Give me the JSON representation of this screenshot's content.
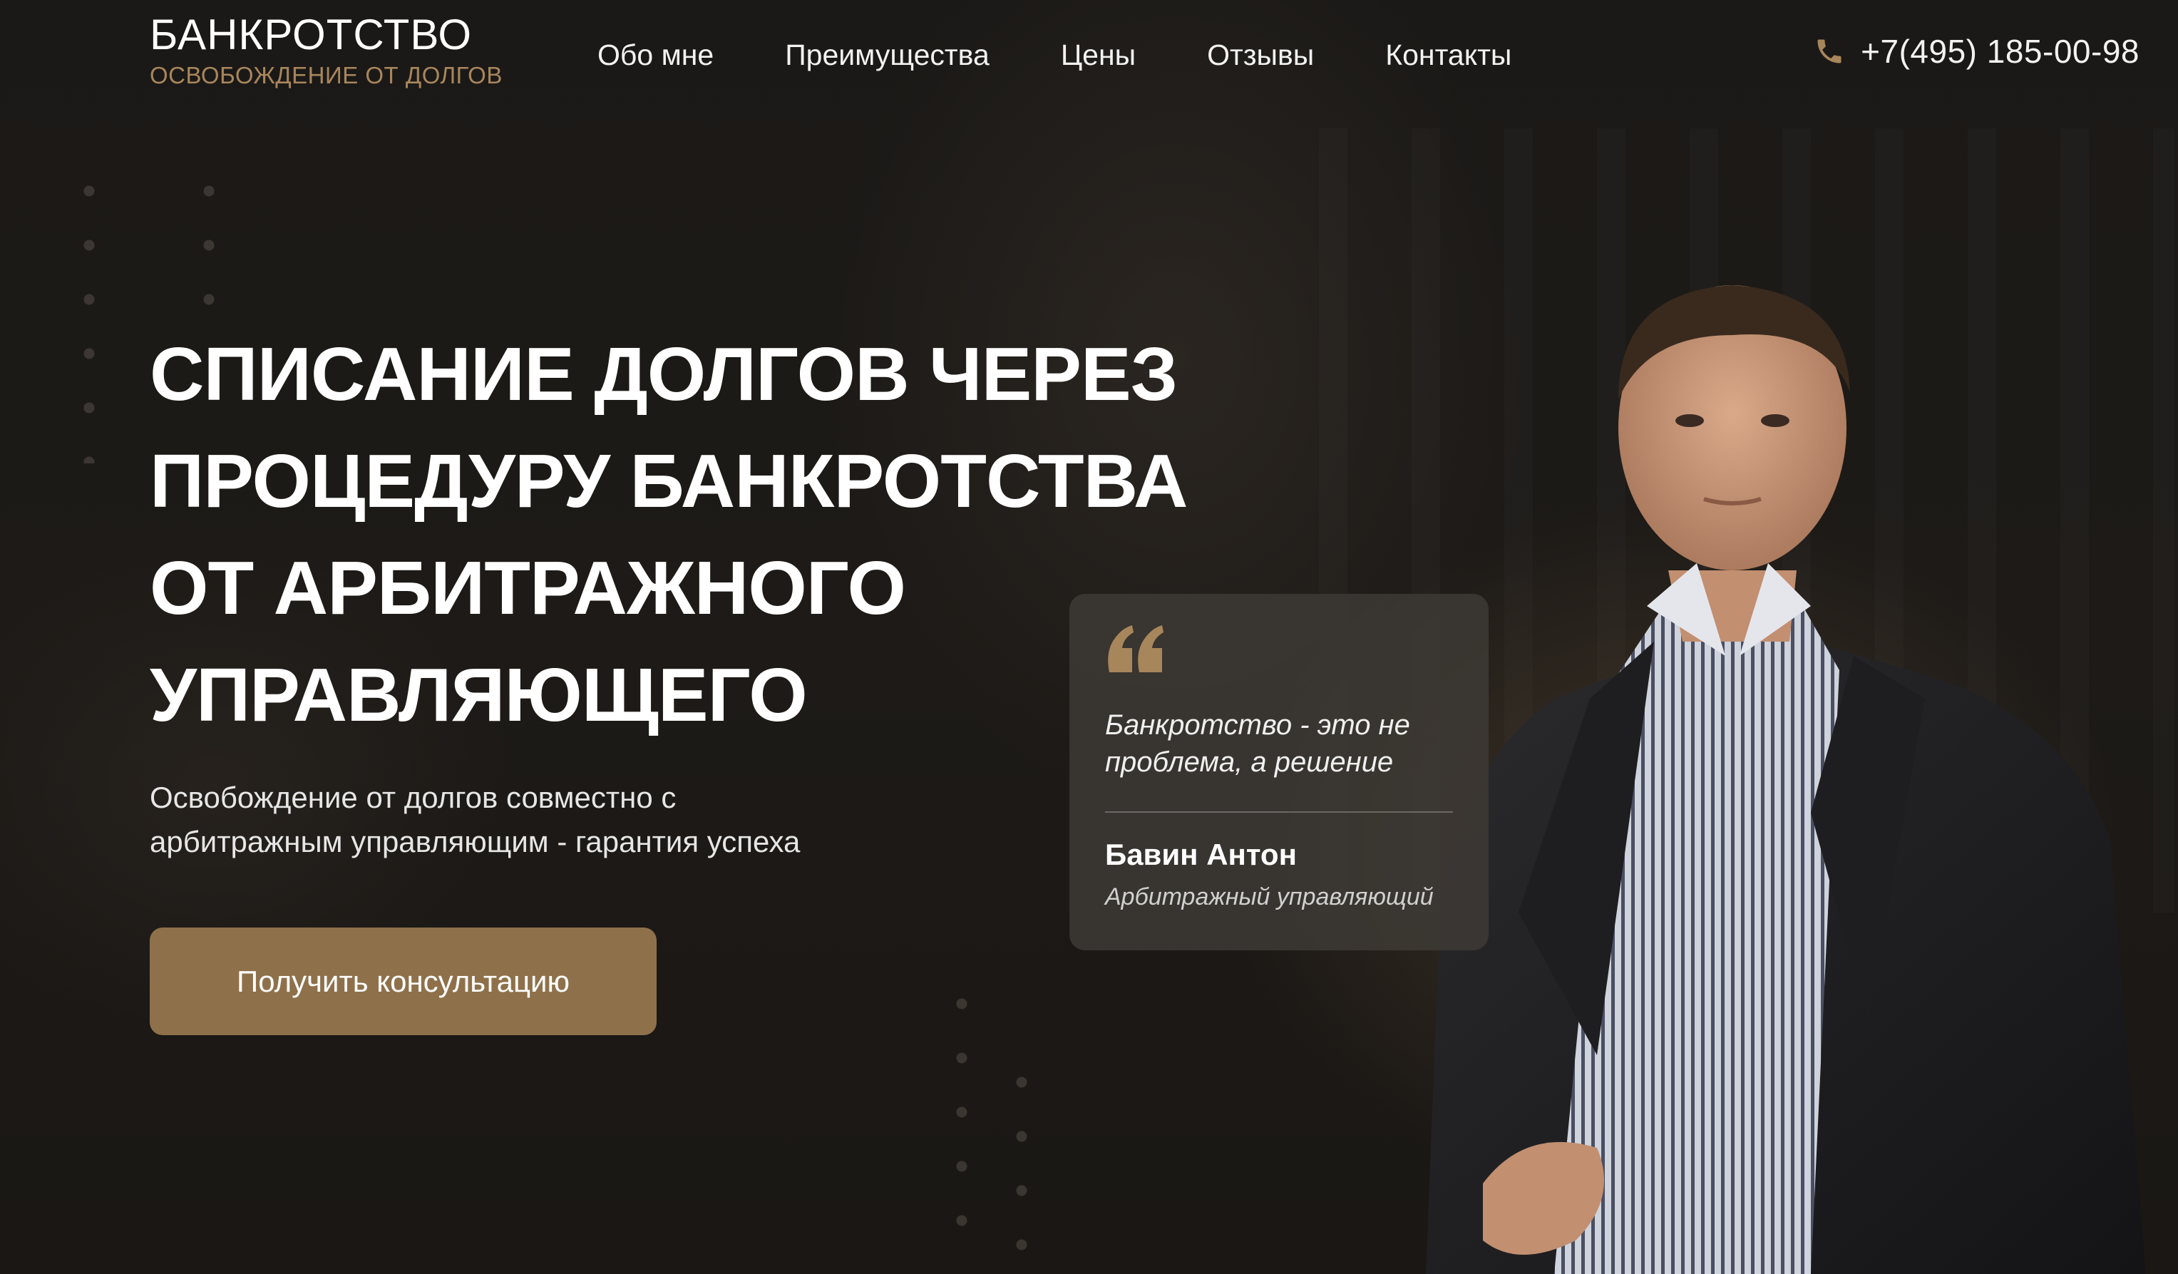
{
  "header": {
    "logo_title": "БАНКРОТСТВО",
    "logo_subtitle": "ОСВОБОЖДЕНИЕ ОТ ДОЛГОВ",
    "nav": [
      {
        "label": "Обо мне"
      },
      {
        "label": "Преимущества"
      },
      {
        "label": "Цены"
      },
      {
        "label": "Отзывы"
      },
      {
        "label": "Контакты"
      }
    ],
    "phone": "+7(495) 185-00-98",
    "phone_icon": "phone-icon"
  },
  "hero": {
    "title_lines": [
      "СПИСАНИЕ ДОЛГОВ ЧЕРЕЗ",
      "ПРОЦЕДУРУ БАНКРОТСТВА",
      "ОТ АРБИТРАЖНОГО",
      "УПРАВЛЯЮЩЕГО"
    ],
    "subtitle_lines": [
      "Освобождение от долгов совместно с",
      "арбитражным управляющим - гарантия успеха"
    ],
    "cta_label": "Получить консультацию"
  },
  "quote": {
    "icon": "quote-icon",
    "text_lines": [
      "Банкротство - это не",
      "проблема, а решение"
    ],
    "author": "Бавин Антон",
    "role": "Арбитражный управляющий"
  },
  "colors": {
    "background": "#1b1917",
    "accent": "#8e714b",
    "accent_text": "#a8865c",
    "card": "#3e3a36",
    "text": "#ffffff"
  }
}
